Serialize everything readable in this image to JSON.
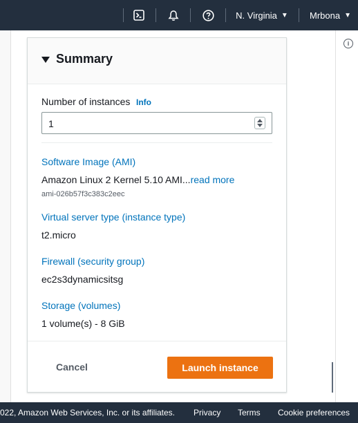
{
  "topnav": {
    "icons": [
      "terminal-icon",
      "bell-icon",
      "help-icon"
    ],
    "region": "N. Virginia",
    "user": "Mrbona"
  },
  "summary": {
    "title": "Summary",
    "instances_label": "Number of instances",
    "info_label": "Info",
    "instances_value": "1",
    "ami_heading": "Software Image (AMI)",
    "ami_name": "Amazon Linux 2 Kernel 5.10 AMI...",
    "read_more": "read more",
    "ami_id": "ami-026b57f3c383c2eec",
    "instance_type_heading": "Virtual server type (instance type)",
    "instance_type": "t2.micro",
    "firewall_heading": "Firewall (security group)",
    "security_group": "ec2s3dynamicsitsg",
    "storage_heading": "Storage (volumes)",
    "storage": "1 volume(s) - 8 GiB",
    "cancel_label": "Cancel",
    "launch_label": "Launch instance"
  },
  "footer": {
    "copyright": "022, Amazon Web Services, Inc. or its affiliates.",
    "privacy": "Privacy",
    "terms": "Terms",
    "cookies": "Cookie preferences"
  },
  "colors": {
    "nav_bg": "#232f3e",
    "link": "#0073bb",
    "primary_button": "#ec7211"
  }
}
